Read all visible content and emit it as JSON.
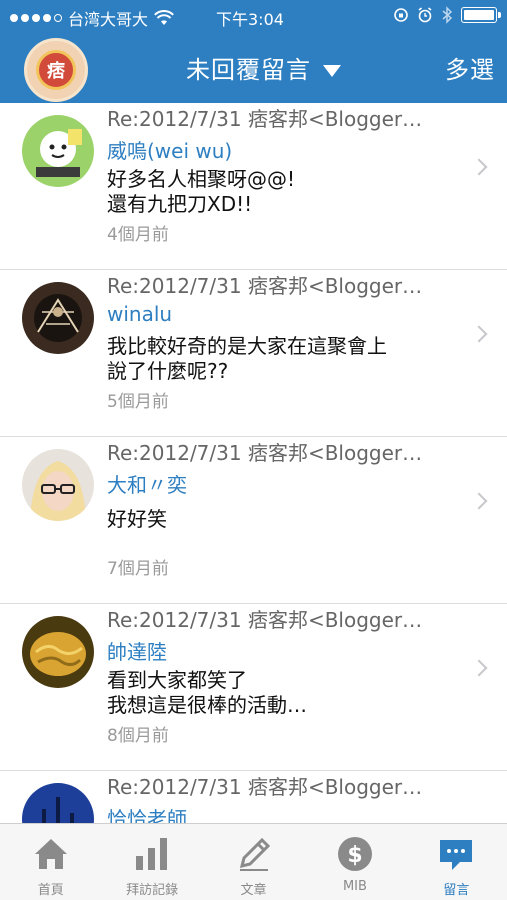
{
  "status_bar": {
    "carrier": "台湾大哥大",
    "time": "下午3:04"
  },
  "nav": {
    "avatar_text": "痞",
    "title": "未回覆留言",
    "action": "多選"
  },
  "messages": [
    {
      "subject": "Re:2012/7/31 痞客邦<Blogger… ",
      "author": "威嗚(wei wu)",
      "body": "好多名人相聚呀@@!\n還有九把刀XD!!",
      "time": "4個月前"
    },
    {
      "subject": "Re:2012/7/31 痞客邦<Blogger… ",
      "author": "winalu",
      "body": "我比較好奇的是大家在這聚會上\n說了什麼呢??",
      "time": "5個月前"
    },
    {
      "subject": "Re:2012/7/31 痞客邦<Blogger… ",
      "author": "大和〃奕",
      "body": "好好笑",
      "time": "7個月前"
    },
    {
      "subject": "Re:2012/7/31 痞客邦<Blogger… ",
      "author": "帥達陸",
      "body": "看到大家都笑了\n我想這是很棒的活動…",
      "time": "8個月前"
    },
    {
      "subject": "Re:2012/7/31 痞客邦<Blogger… ",
      "author": "恰恰老師",
      "body": "",
      "time": ""
    }
  ],
  "tabs": [
    {
      "label": "首頁",
      "icon": "home-icon"
    },
    {
      "label": "拜訪記錄",
      "icon": "bar-chart-icon"
    },
    {
      "label": "文章",
      "icon": "pencil-icon"
    },
    {
      "label": "MIB",
      "icon": "dollar-icon"
    },
    {
      "label": "留言",
      "icon": "chat-bubble-icon"
    }
  ],
  "colors": {
    "primary": "#2e7fc1",
    "tab_inactive": "#8a8a8a"
  }
}
